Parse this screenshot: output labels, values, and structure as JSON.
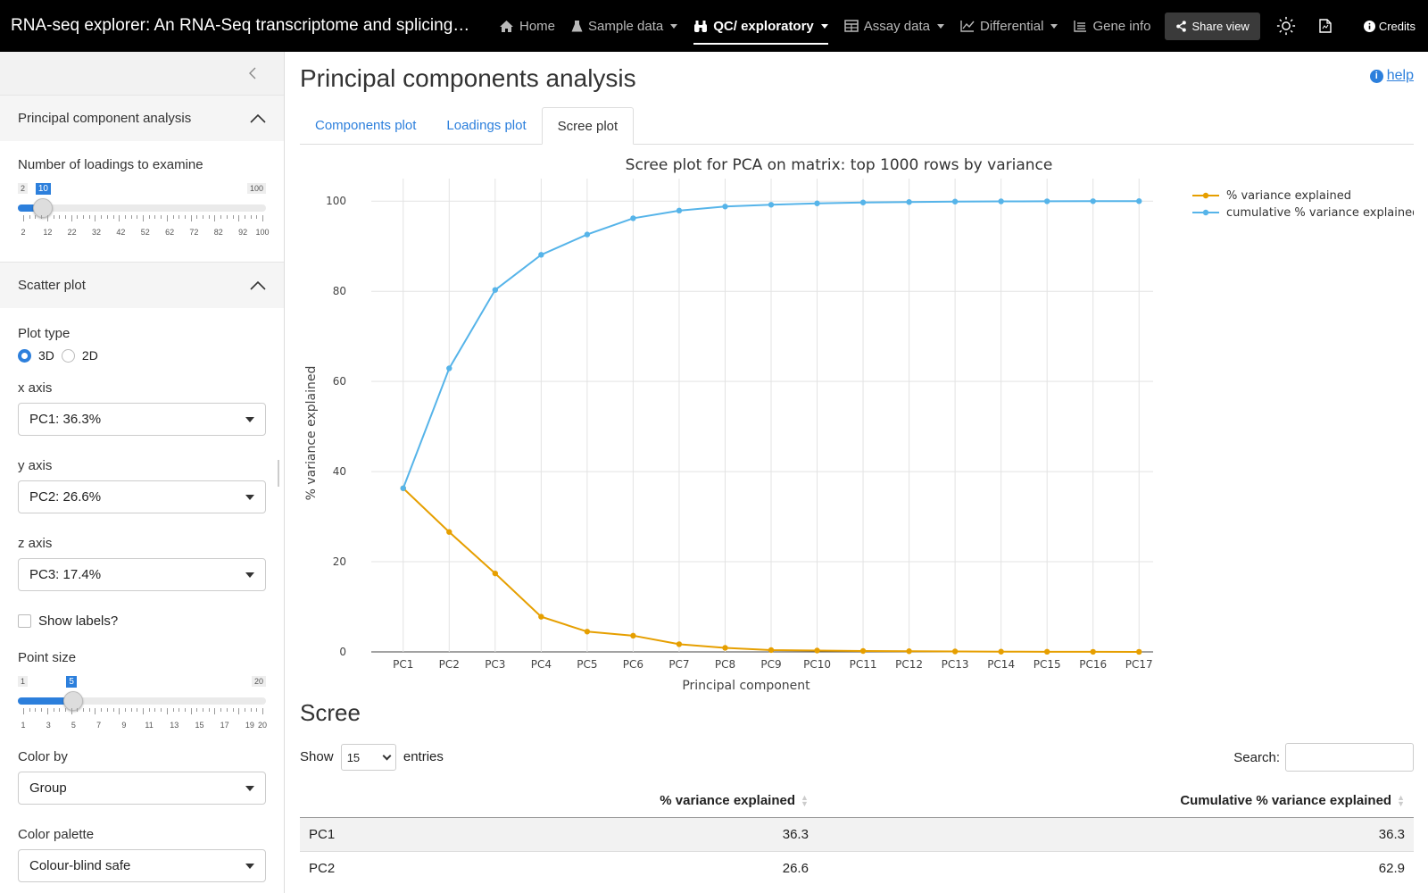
{
  "app": {
    "title": "RNA-seq explorer: An RNA-Seq transcriptome and splicing d…"
  },
  "nav": {
    "items": [
      {
        "label": "Home",
        "icon": "home-icon",
        "dropdown": false,
        "active": false
      },
      {
        "label": "Sample data",
        "icon": "flask-icon",
        "dropdown": true,
        "active": false
      },
      {
        "label": "QC/ exploratory",
        "icon": "binoculars-icon",
        "dropdown": true,
        "active": true
      },
      {
        "label": "Assay data",
        "icon": "table-icon",
        "dropdown": true,
        "active": false
      },
      {
        "label": "Differential",
        "icon": "line-chart-icon",
        "dropdown": true,
        "active": false
      },
      {
        "label": "Gene info",
        "icon": "list-icon",
        "dropdown": false,
        "active": false
      }
    ],
    "share_label": "Share view",
    "credits_label": "Credits"
  },
  "sidebar": {
    "pca_header": "Principal component analysis",
    "loadings_label": "Number of loadings to examine",
    "loadings_slider": {
      "min": 2,
      "max": 100,
      "value": 10,
      "ticks": [
        "2",
        "12",
        "22",
        "32",
        "42",
        "52",
        "62",
        "72",
        "82",
        "92",
        "100"
      ]
    },
    "scatter_header": "Scatter plot",
    "plot_type_label": "Plot type",
    "plot_type_options": [
      "3D",
      "2D"
    ],
    "plot_type_selected": "3D",
    "x_axis_label": "x axis",
    "x_axis_value": "PC1: 36.3%",
    "y_axis_label": "y axis",
    "y_axis_value": "PC2: 26.6%",
    "z_axis_label": "z axis",
    "z_axis_value": "PC3: 17.4%",
    "show_labels_label": "Show labels?",
    "point_size_label": "Point size",
    "point_size_slider": {
      "min": 1,
      "max": 20,
      "value": 5,
      "ticks": [
        "1",
        "3",
        "5",
        "7",
        "9",
        "11",
        "13",
        "15",
        "17",
        "19",
        "20"
      ]
    },
    "color_by_label": "Color by",
    "color_by_value": "Group",
    "palette_label": "Color palette",
    "palette_value": "Colour-blind safe"
  },
  "main": {
    "title": "Principal components analysis",
    "help_label": "help",
    "tabs": [
      {
        "label": "Components plot",
        "active": false
      },
      {
        "label": "Loadings plot",
        "active": false
      },
      {
        "label": "Scree plot",
        "active": true
      }
    ],
    "section_title": "Scree",
    "table": {
      "show_prefix": "Show",
      "show_value": "15",
      "show_suffix": "entries",
      "search_label": "Search:",
      "columns": [
        "",
        "% variance explained",
        "Cumulative % variance explained"
      ],
      "rows": [
        [
          "PC1",
          "36.3",
          "36.3"
        ],
        [
          "PC2",
          "26.6",
          "62.9"
        ]
      ]
    }
  },
  "chart_data": {
    "type": "line",
    "title": "Scree plot for PCA on matrix: top 1000 rows by variance",
    "xlabel": "Principal component",
    "ylabel": "% variance explained",
    "categories": [
      "PC1",
      "PC2",
      "PC3",
      "PC4",
      "PC5",
      "PC6",
      "PC7",
      "PC8",
      "PC9",
      "PC10",
      "PC11",
      "PC12",
      "PC13",
      "PC14",
      "PC15",
      "PC16",
      "PC17"
    ],
    "ylim": [
      0,
      105
    ],
    "yticks": [
      0,
      20,
      40,
      60,
      80,
      100
    ],
    "grid": true,
    "legend_position": "top-right",
    "series": [
      {
        "name": "% variance explained",
        "color": "#e69f00",
        "values": [
          36.3,
          26.6,
          17.4,
          7.8,
          4.5,
          3.6,
          1.7,
          0.9,
          0.4,
          0.3,
          0.2,
          0.15,
          0.1,
          0.05,
          0.03,
          0.02,
          0.01
        ]
      },
      {
        "name": "cumulative % variance explained",
        "color": "#56b4e9",
        "values": [
          36.3,
          62.9,
          80.3,
          88.1,
          92.6,
          96.2,
          97.9,
          98.8,
          99.2,
          99.5,
          99.7,
          99.8,
          99.9,
          99.95,
          99.97,
          99.99,
          100
        ]
      }
    ]
  }
}
